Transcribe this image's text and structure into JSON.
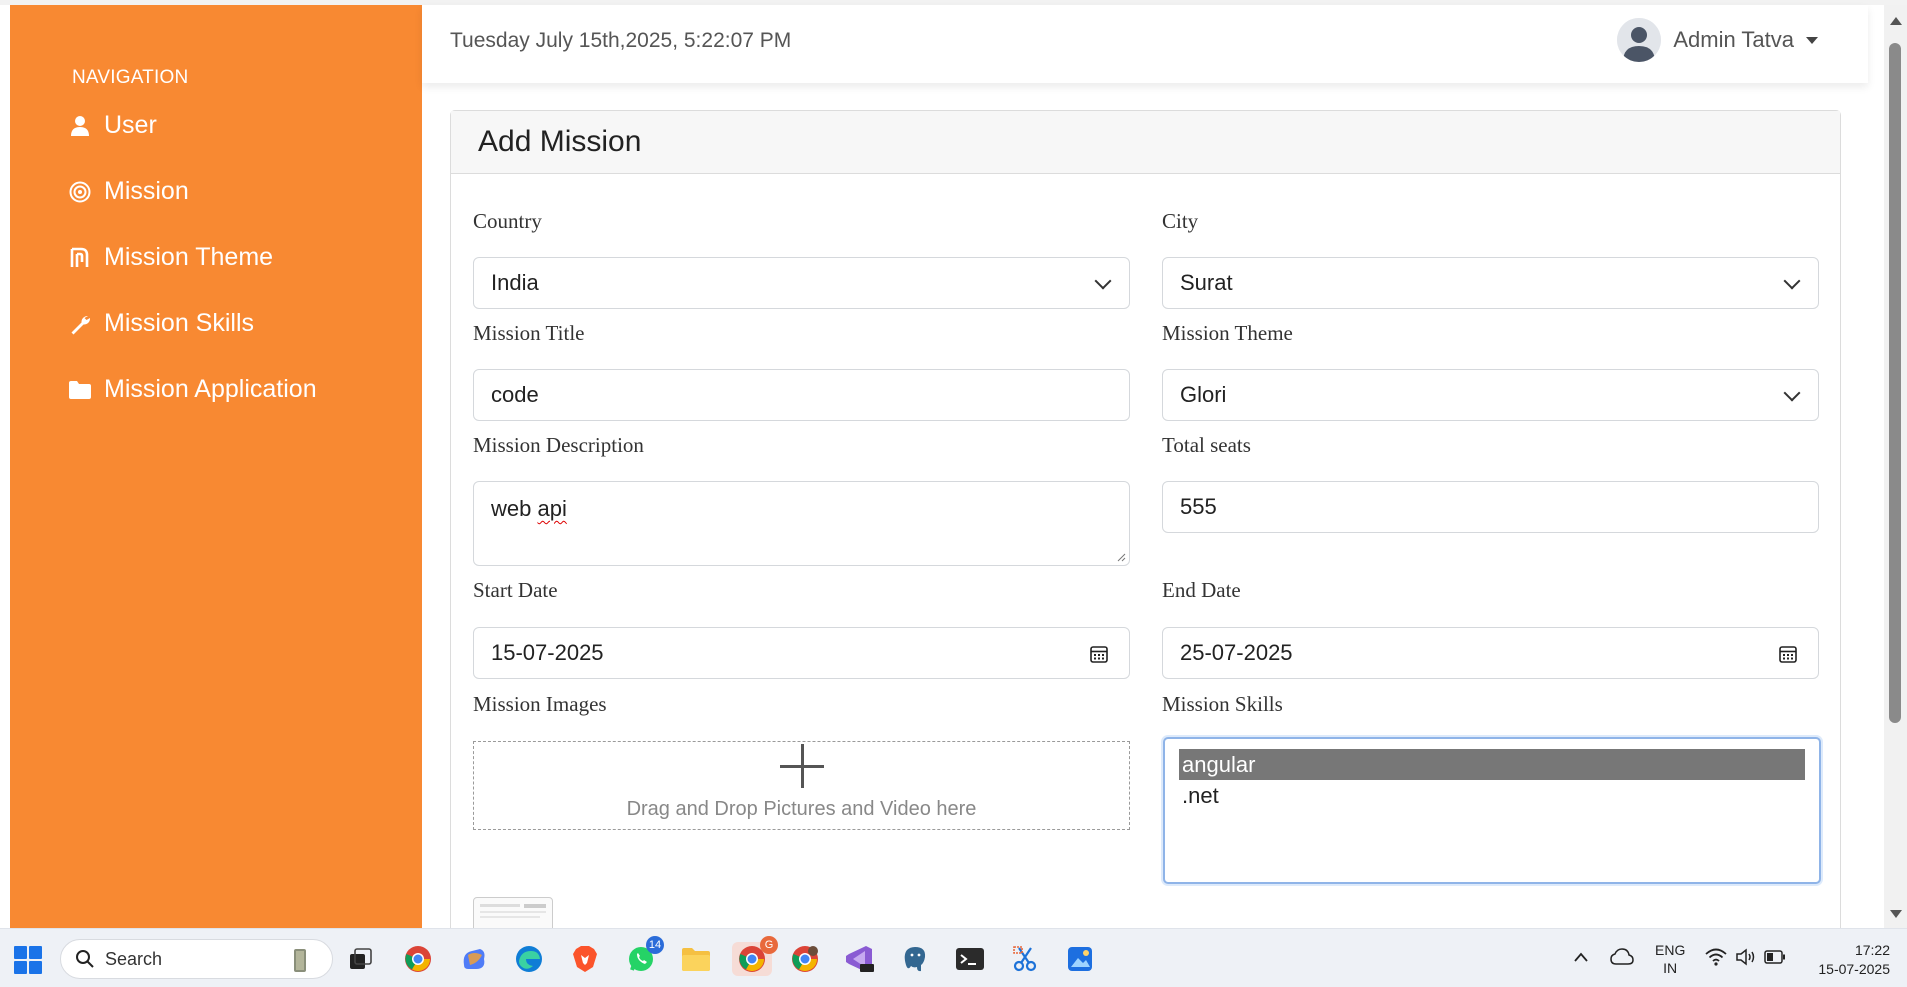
{
  "sidebar": {
    "heading": "NAVIGATION",
    "items": [
      {
        "label": "User",
        "icon": "user-icon"
      },
      {
        "label": "Mission",
        "icon": "target-icon"
      },
      {
        "label": "Mission Theme",
        "icon": "theme-icon"
      },
      {
        "label": "Mission Skills",
        "icon": "wrench-icon"
      },
      {
        "label": "Mission Application",
        "icon": "folder-icon"
      }
    ]
  },
  "header": {
    "datetime": "Tuesday July 15th,2025, 5:22:07 PM",
    "user_name": "Admin Tatva"
  },
  "form": {
    "title": "Add Mission",
    "country": {
      "label": "Country",
      "value": "India"
    },
    "city": {
      "label": "City",
      "value": "Surat"
    },
    "mission_title": {
      "label": "Mission Title",
      "value": "code"
    },
    "mission_theme": {
      "label": "Mission Theme",
      "value": "Glori"
    },
    "mission_description": {
      "label": "Mission Description",
      "value_1": "web ",
      "value_2": "api"
    },
    "total_seats": {
      "label": "Total seats",
      "value": "555"
    },
    "start_date": {
      "label": "Start Date",
      "value": "15-07-2025"
    },
    "end_date": {
      "label": "End Date",
      "value": "25-07-2025"
    },
    "mission_images": {
      "label": "Mission Images",
      "drop_text": "Drag and Drop Pictures and Video here"
    },
    "mission_skills": {
      "label": "Mission Skills",
      "options": [
        "angular",
        ".net"
      ],
      "selected": "angular"
    }
  },
  "taskbar": {
    "search_label": "Search",
    "whatsapp_badge": "14",
    "chrome_badge": "G",
    "language": "ENG",
    "region": "IN",
    "time": "17:22",
    "date": "15-07-2025"
  },
  "colors": {
    "sidebar_bg": "#f88932",
    "accent": "#1a73e8"
  }
}
